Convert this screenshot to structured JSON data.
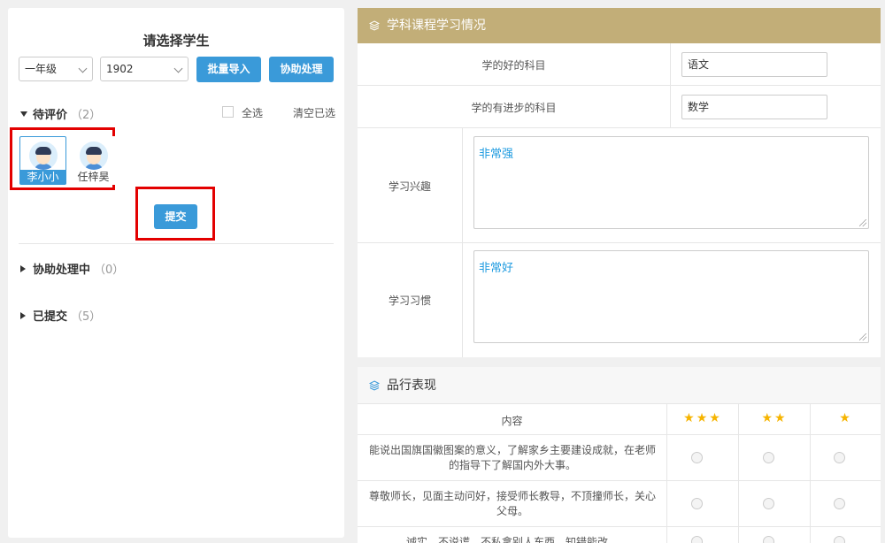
{
  "left": {
    "title": "请选择学生",
    "grade_select": "一年级",
    "class_select": "1902",
    "import_button": "批量导入",
    "assist_button": "协助处理",
    "pending": {
      "label": "待评价",
      "count": "（2）"
    },
    "select_all": "全选",
    "clear_selected": "清空已选",
    "students": [
      {
        "name": "李小小",
        "selected": true
      },
      {
        "name": "任梓昊",
        "selected": false
      }
    ],
    "submit_button": "提交",
    "assisting": {
      "label": "协助处理中",
      "count": "（0）"
    },
    "submitted": {
      "label": "已提交",
      "count": "（5）"
    }
  },
  "study": {
    "title": "学科课程学习情况",
    "rows": [
      {
        "label": "学的好的科目",
        "value": "语文"
      },
      {
        "label": "学的有进步的科目",
        "value": "数学"
      },
      {
        "label": "学习兴趣",
        "value": "非常强"
      },
      {
        "label": "学习习惯",
        "value": "非常好"
      }
    ]
  },
  "conduct": {
    "title": "品行表现",
    "header": {
      "content": "内容",
      "star3": "★★★",
      "star2": "★★",
      "star1": "★"
    },
    "items": [
      "能说出国旗国徽图案的意义，了解家乡主要建设成就，在老师的指导下了解国内外大事。",
      "尊敬师长，见面主动问好，接受师长教导，不顶撞师长，关心父母。",
      "诚实，不说谎，不私拿别人东西，知错能改。"
    ]
  },
  "colors": {
    "accent": "#3a9ad9",
    "header_gold": "#c2ae78",
    "highlight": "#e30000",
    "star": "#f6b400"
  }
}
